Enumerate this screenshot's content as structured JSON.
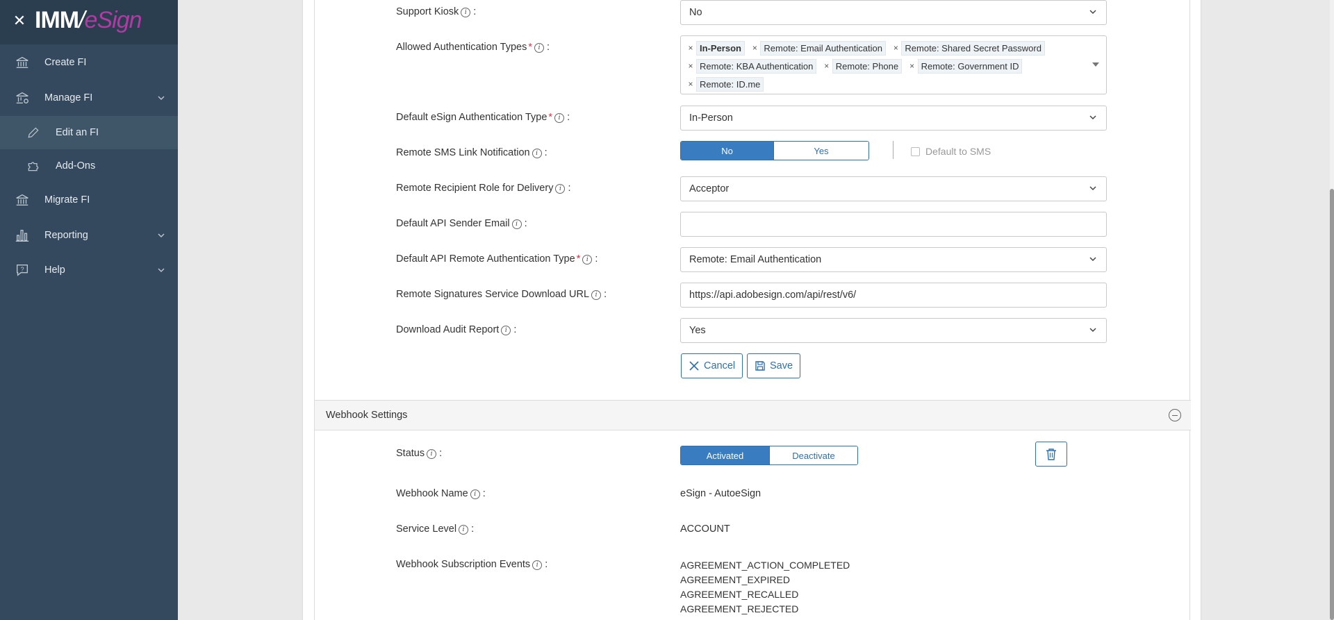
{
  "app": {
    "logo_main": "IMM",
    "logo_accent": "eSign"
  },
  "sidebar": {
    "items": [
      {
        "label": "Create FI",
        "icon": "bank-icon"
      },
      {
        "label": "Manage FI",
        "icon": "bank-gear-icon"
      },
      {
        "label": "Edit an FI",
        "icon": "pencil-icon"
      },
      {
        "label": "Add-Ons",
        "icon": "puzzle-icon"
      },
      {
        "label": "Migrate FI",
        "icon": "bank-icon"
      },
      {
        "label": "Reporting",
        "icon": "bar-chart-icon"
      },
      {
        "label": "Help",
        "icon": "help-chat-icon"
      }
    ]
  },
  "form": {
    "support_kiosk": {
      "label": "Support Kiosk",
      "value": "No"
    },
    "allowed_auth": {
      "label": "Allowed Authentication Types",
      "tags": [
        "In-Person",
        "Remote: Email Authentication",
        "Remote: Shared Secret Password",
        "Remote: KBA Authentication",
        "Remote: Phone",
        "Remote: Government ID",
        "Remote: ID.me"
      ]
    },
    "default_esign_auth": {
      "label": "Default eSign Authentication Type",
      "value": "In-Person"
    },
    "remote_sms": {
      "label": "Remote SMS Link Notification",
      "no": "No",
      "yes": "Yes",
      "selected": "No",
      "default_sms_label": "Default to SMS"
    },
    "remote_role": {
      "label": "Remote Recipient Role for Delivery",
      "value": "Acceptor"
    },
    "api_sender_email": {
      "label": "Default API Sender Email",
      "value": ""
    },
    "api_remote_auth": {
      "label": "Default API Remote Authentication Type",
      "value": "Remote: Email Authentication"
    },
    "download_url": {
      "label": "Remote Signatures Service Download URL",
      "value": "https://api.adobesign.com/api/rest/v6/"
    },
    "audit_report": {
      "label": "Download Audit Report",
      "value": "Yes"
    },
    "cancel_label": "Cancel",
    "save_label": "Save"
  },
  "webhook": {
    "title": "Webhook Settings",
    "status": {
      "label": "Status",
      "activated": "Activated",
      "deactivate": "Deactivate",
      "selected": "Activated"
    },
    "name": {
      "label": "Webhook Name",
      "value": "eSign - AutoeSign"
    },
    "service_level": {
      "label": "Service Level",
      "value": "ACCOUNT"
    },
    "events": {
      "label": "Webhook Subscription Events",
      "values": [
        "AGREEMENT_ACTION_COMPLETED",
        "AGREEMENT_EXPIRED",
        "AGREEMENT_RECALLED",
        "AGREEMENT_REJECTED"
      ]
    }
  },
  "colors": {
    "sidebar_bg": "#34495e",
    "accent_blue": "#3a7cc0",
    "brand_magenta": "#b23aa5",
    "required": "#d9324b"
  }
}
